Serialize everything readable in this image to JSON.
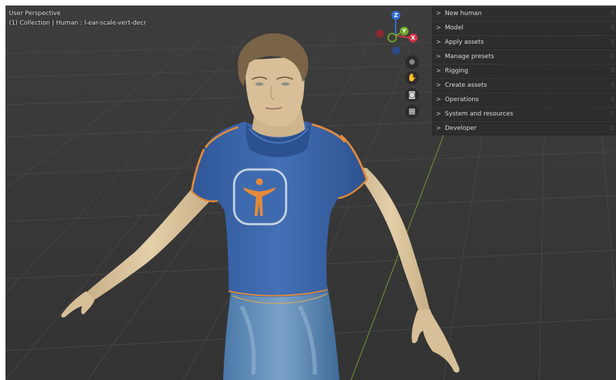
{
  "viewport": {
    "perspective_label": "User Perspective",
    "object_info": "(1) Collection | Human : l-ear-scale-vert-decr"
  },
  "gizmo": {
    "axes": [
      {
        "name": "z-axis",
        "letter": "Z",
        "color": "#2f6fd6"
      },
      {
        "name": "y-axis",
        "letter": "Y",
        "color": "#6fa52a"
      },
      {
        "name": "x-axis",
        "letter": "X",
        "color": "#d2364a"
      },
      {
        "name": "neg-x-axis",
        "letter": "",
        "color": "#8a2a36"
      },
      {
        "name": "neg-y-axis",
        "letter": "",
        "color": "#3e5f1e"
      },
      {
        "name": "neg-z-axis",
        "letter": "",
        "color": "#2a4a85"
      }
    ]
  },
  "nav_tools": [
    {
      "name": "zoom-icon",
      "glyph": "⊕"
    },
    {
      "name": "pan-hand-icon",
      "glyph": "✋"
    },
    {
      "name": "camera-icon",
      "glyph": "🎥"
    },
    {
      "name": "grid-view-icon",
      "glyph": "▦"
    }
  ],
  "sidebar": {
    "panels": [
      {
        "label": "New human"
      },
      {
        "label": "Model"
      },
      {
        "label": "Apply assets"
      },
      {
        "label": "Manage presets"
      },
      {
        "label": "Rigging"
      },
      {
        "label": "Create assets"
      },
      {
        "label": "Operations"
      },
      {
        "label": "System and resources"
      },
      {
        "label": "Developer"
      }
    ],
    "chevron": ">",
    "grip": "⠿"
  },
  "colors": {
    "viewport_bg": "#3a3a3a",
    "panel_bg": "#2c2c2c",
    "shirt": "#3a64a8",
    "shirt_trim": "#e38a3a",
    "skin": "#d9c29a",
    "hair": "#7a6448",
    "jeans": "#4f7fb0"
  }
}
